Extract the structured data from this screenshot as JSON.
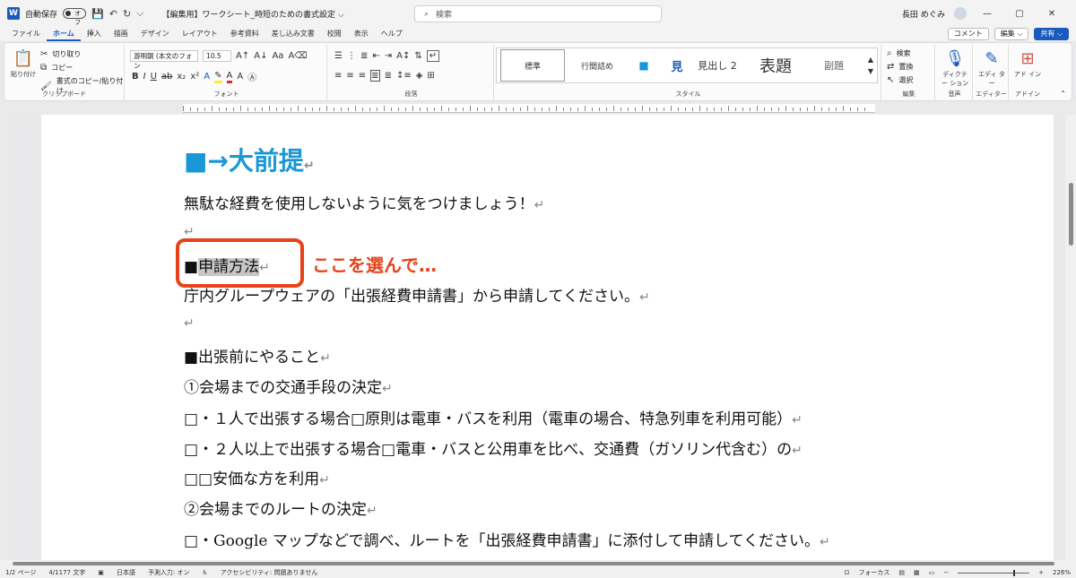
{
  "titlebar": {
    "autosave_label": "自動保存",
    "autosave_state": "オフ",
    "doc_title": "【編集用】ワークシート_時短のための書式設定 ⌵",
    "search_placeholder": "検索",
    "user_name": "長田 めぐみ"
  },
  "tabs": [
    "ファイル",
    "ホーム",
    "挿入",
    "描画",
    "デザイン",
    "レイアウト",
    "参考資料",
    "差し込み文書",
    "校閲",
    "表示",
    "ヘルプ"
  ],
  "tab_actions": {
    "comment": "コメント",
    "edit": "編集 ⌵",
    "share": "共有 ⌵"
  },
  "ribbon": {
    "clipboard": {
      "paste": "貼り付け",
      "cut": "切り取り",
      "copy": "コピー",
      "format_painter": "書式のコピー/貼り付け",
      "label": "クリップボード"
    },
    "font": {
      "name": "游明朝 (本文のフォン",
      "size": "10.5",
      "label": "フォント"
    },
    "paragraph": {
      "label": "段落"
    },
    "styles": {
      "items": [
        "標準",
        "行間詰め",
        "■",
        "見",
        "見出し 2",
        "表題",
        "副題"
      ],
      "label": "スタイル"
    },
    "editing": {
      "find": "検索",
      "replace": "置換",
      "select": "選択",
      "label": "編集"
    },
    "voice": {
      "dictate": "ディクテー ション",
      "label": "音声"
    },
    "editor": {
      "name": "エディ ター",
      "label": "エディター"
    },
    "addins": {
      "name": "アド イン",
      "label": "アドイン"
    }
  },
  "document": {
    "heading": "■→大前提",
    "lines": [
      "無駄な経費を使用しないように気をつけましょう！",
      "",
      "■申請方法",
      "庁内グループウェアの「出張経費申請書」から申請してください。",
      "",
      "■出張前にやること",
      "①会場までの交通手段の決定",
      "□・１人で出張する場合□原則は電車・バスを利用（電車の場合、特急列車を利用可能）",
      "□・２人以上で出張する場合□電車・バスと公用車を比べ、交通費（ガソリン代含む）の",
      "□□安価な方を利用",
      "②会場までのルートの決定",
      "□・Google マップなどで調べ、ルートを「出張経費申請書」に添付して申請してください。"
    ],
    "selected_text": "申請方法",
    "callout": "ここを選んで…"
  },
  "status": {
    "page": "1/2 ページ",
    "words": "4/1177 文字",
    "language": "日本語",
    "predict": "予測入力: オン",
    "accessibility": "アクセシビリティ: 問題ありません",
    "focus": "フォーカス",
    "zoom": "226%"
  },
  "colors": {
    "heading": "#1a98d5",
    "callout": "#e8421b",
    "accent": "#185abd"
  }
}
